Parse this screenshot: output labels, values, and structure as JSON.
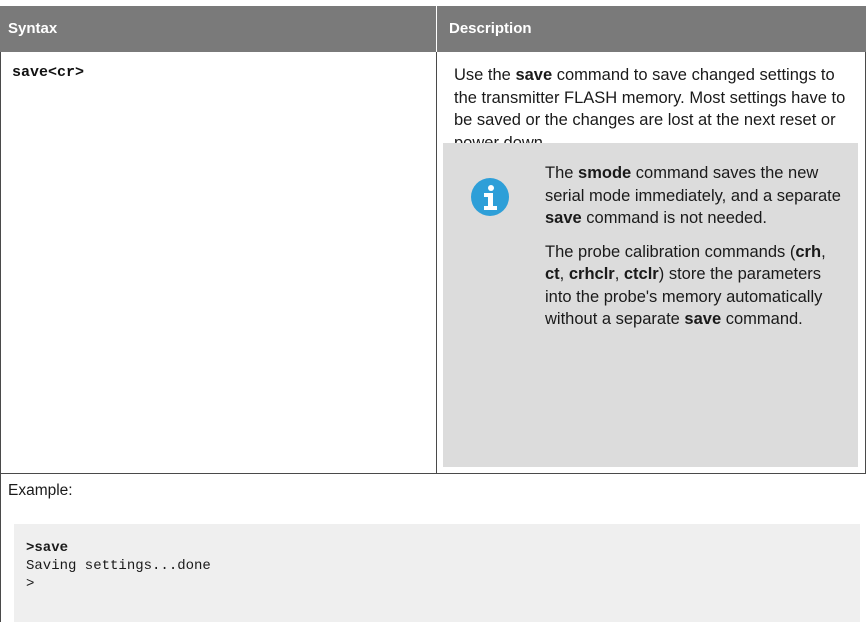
{
  "table": {
    "header": {
      "syntax": "Syntax",
      "description": "Description"
    },
    "syntax": "save<cr>",
    "description": {
      "pre": "Use the ",
      "bold": "save",
      "post": " command to save changed settings to the transmitter FLASH memory. Most settings have to be saved or the changes are lost at the next reset or power down."
    },
    "note": {
      "icon": "info-icon",
      "icon_color": "#2e9fd8",
      "p1": {
        "t1": "The ",
        "b1": "smode",
        "t2": " command saves the new serial mode immediately, and a separate ",
        "b2": "save",
        "t3": " command is not needed."
      },
      "p2": {
        "t1": "The probe calibration commands (",
        "b1": "crh",
        "s1": ", ",
        "b2": "ct",
        "s2": ", ",
        "b3": "crhclr",
        "s3": ", ",
        "b4": "ctclr",
        "t2": ") store the parameters into the probe's memory automatically without a separate ",
        "b5": "save",
        "t3": " command."
      }
    },
    "example": {
      "label": "Example:",
      "lines": [
        ">save",
        "Saving settings...done",
        ">"
      ]
    }
  }
}
